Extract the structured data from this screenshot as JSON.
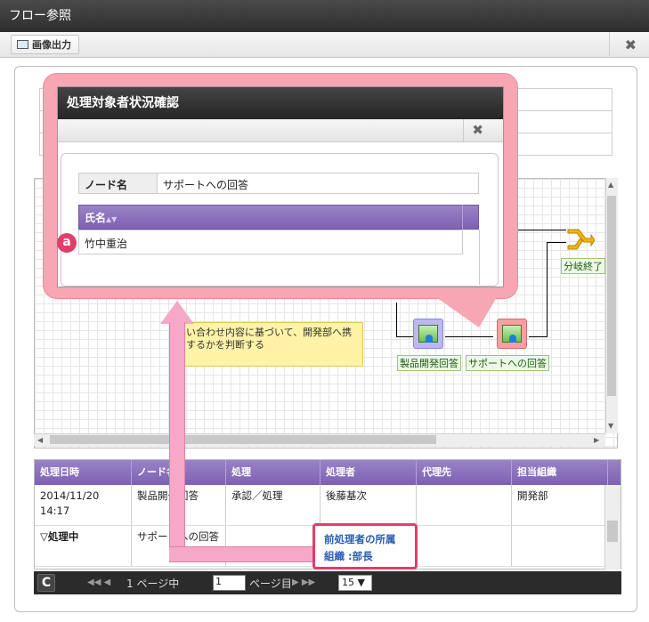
{
  "window": {
    "title": "フロー参照"
  },
  "toolbar": {
    "export_label": "画像出力",
    "close_glyph": "✖"
  },
  "diagram": {
    "note_text": "い合わせ内容に基づいて、開発部へ携するかを判断する",
    "nodes": [
      {
        "label": "製品開発回答"
      },
      {
        "label": "サポートへの回答"
      },
      {
        "label": "分岐終了"
      }
    ]
  },
  "history": {
    "headers": [
      "処理日時",
      "ノード名",
      "処理",
      "処理者",
      "代理先",
      "担当組織"
    ],
    "rows": [
      {
        "date": "2014/11/20",
        "time": "14:17",
        "node": "製品開発回答",
        "action": "承認／処理",
        "user": "後藤基次",
        "proxy": "",
        "org": "開発部"
      },
      {
        "date": "▽処理中",
        "time": "",
        "node": "サポートへの回答",
        "action": "",
        "user": "",
        "proxy": "",
        "org": ""
      }
    ]
  },
  "pager": {
    "refresh_glyph": "C",
    "first_prev": "◀◀ ◀",
    "page_of": "1 ページ中",
    "page_value": "1",
    "page_suffix": "ページ目",
    "next_last": "▶ ▶▶",
    "page_size": "15 ▼"
  },
  "dialog": {
    "title": "処理対象者状況確認",
    "close_glyph": "✖",
    "node_label": "ノード名",
    "node_value": "サポートへの回答",
    "name_header": "氏名",
    "sort_glyph": "▲▼",
    "names": [
      "竹中重治"
    ]
  },
  "annotation": {
    "badge": "a",
    "highlight_line1": "前処理者の所属",
    "highlight_line2": "組織 :部長"
  }
}
